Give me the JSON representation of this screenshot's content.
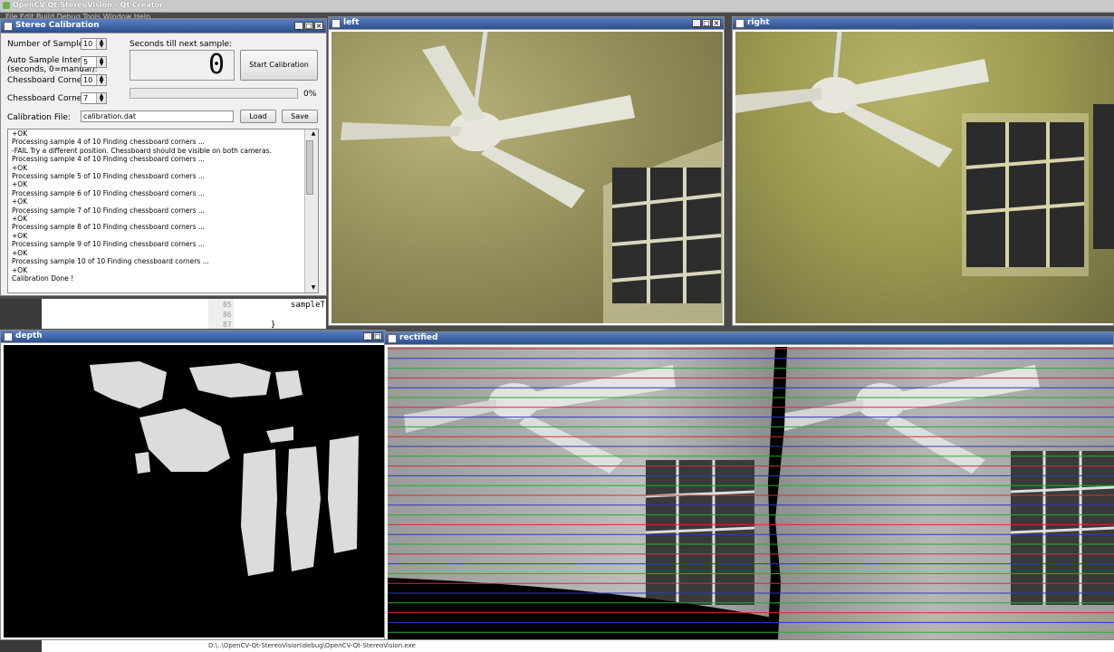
{
  "app": {
    "title": "OpenCV-Qt-StereoVision - Qt Creator",
    "menu_text": "File  Edit  Build  Debug  Tools  Window  Help"
  },
  "calib": {
    "title": "Stereo Calibration",
    "num_samples_label": "Number of Samples:",
    "num_samples_value": "10",
    "interval_label_1": "Auto Sample Interval",
    "interval_label_2": "(seconds, 0=manual):",
    "interval_value": "5",
    "corners_x_label": "Chessboard Corners X:",
    "corners_x_value": "10",
    "corners_y_label": "Chessboard Corners X:",
    "corners_y_value": "7",
    "seconds_label": "Seconds till next sample:",
    "seconds_value": "0",
    "start_button": "Start Calibration",
    "progress_percent": "0%",
    "progress_fraction": 0,
    "file_label": "Calibration File:",
    "file_value": "calibration.dat",
    "load_button": "Load",
    "save_button": "Save",
    "log_lines": [
      "+OK",
      "Processing sample 4 of 10 Finding chessboard corners ...",
      "-FAIL Try a different position. Chessboard should be visible on both cameras.",
      "Processing sample 4 of 10 Finding chessboard corners ...",
      " +OK",
      "Processing sample 5 of 10 Finding chessboard corners ...",
      " +OK",
      "Processing sample 6 of 10 Finding chessboard corners ...",
      " +OK",
      "Processing sample 7 of 10 Finding chessboard corners ...",
      " +OK",
      "Processing sample 8 of 10 Finding chessboard corners ...",
      " +OK",
      "Processing sample 9 of 10 Finding chessboard corners ...",
      " +OK",
      "Processing sample 10 of 10 Finding chessboard corners ...",
      " +OK",
      "Calibration Done !"
    ]
  },
  "windows": {
    "left": "left",
    "right": "right",
    "depth": "depth",
    "rectified": "rectified"
  },
  "editor": {
    "lines": [
      "85",
      "86",
      "87"
    ],
    "code_1": "sampleT",
    "code_2": "}"
  },
  "statusbar": {
    "text": "D:\\..\\OpenCV-Qt-StereoVision\\debug\\OpenCV-Qt-StereoVision.exe"
  },
  "colors": {
    "cam_tint": "#a8a062",
    "depth_bg": "#000000",
    "title_blue": "#2c4f8f"
  }
}
